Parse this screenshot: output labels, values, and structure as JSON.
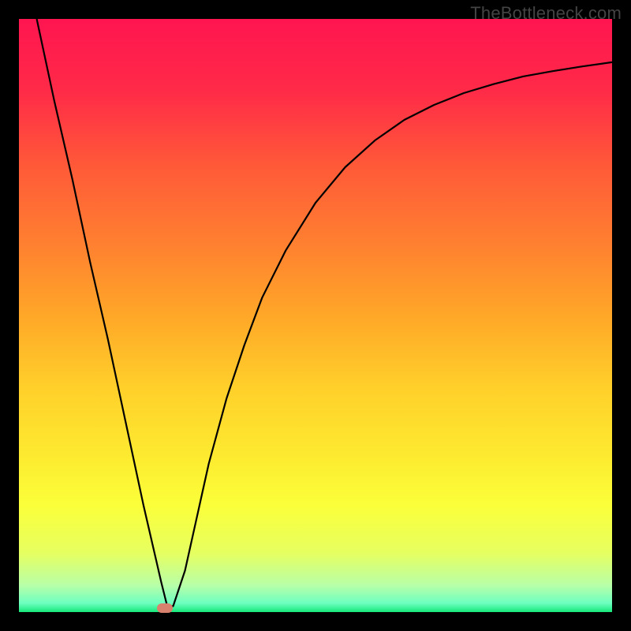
{
  "watermark": "TheBottleneck.com",
  "chart_data": {
    "type": "line",
    "title": "",
    "xlabel": "",
    "ylabel": "",
    "xlim": [
      0,
      100
    ],
    "ylim": [
      0,
      100
    ],
    "grid": false,
    "series": [
      {
        "name": "curve",
        "x": [
          3,
          6,
          9,
          12,
          15,
          18,
          21,
          24,
          25,
          26,
          28,
          30,
          32,
          35,
          38,
          41,
          45,
          50,
          55,
          60,
          65,
          70,
          75,
          80,
          85,
          90,
          95,
          100
        ],
        "y": [
          100,
          86,
          73,
          59,
          46,
          32,
          18,
          5,
          1,
          1,
          7,
          16,
          25,
          36,
          45,
          53,
          61,
          69,
          75,
          79.5,
          83,
          85.5,
          87.5,
          89,
          90.3,
          91.2,
          92,
          92.7
        ]
      }
    ],
    "marker": {
      "x": 24.6,
      "y": 0.6
    },
    "gradient_stops": [
      {
        "offset": 0.0,
        "color": "#ff1550"
      },
      {
        "offset": 0.12,
        "color": "#ff2a48"
      },
      {
        "offset": 0.25,
        "color": "#ff5a38"
      },
      {
        "offset": 0.38,
        "color": "#ff8030"
      },
      {
        "offset": 0.5,
        "color": "#ffa728"
      },
      {
        "offset": 0.62,
        "color": "#ffcf2a"
      },
      {
        "offset": 0.74,
        "color": "#fdeb30"
      },
      {
        "offset": 0.82,
        "color": "#fbff3a"
      },
      {
        "offset": 0.9,
        "color": "#e6ff60"
      },
      {
        "offset": 0.955,
        "color": "#b8ffa8"
      },
      {
        "offset": 0.985,
        "color": "#6dffc0"
      },
      {
        "offset": 1.0,
        "color": "#16e87b"
      }
    ]
  }
}
